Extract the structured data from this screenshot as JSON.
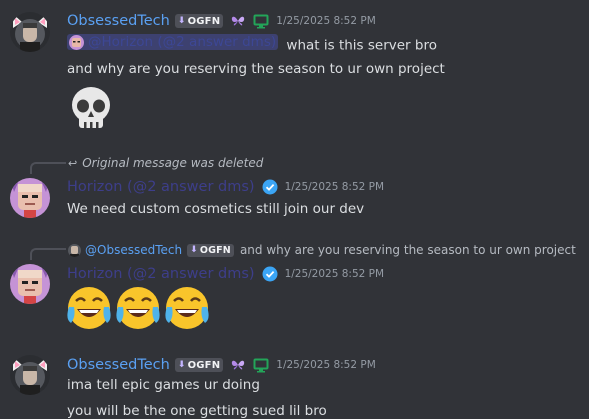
{
  "messages": [
    {
      "author": "ObsessedTech",
      "tag": "OGFN",
      "timestamp": "1/25/2025 8:52 PM",
      "mention": "@Horizon (@2 answer dms)",
      "line1_text": "what is this server bro",
      "line2_text": "and why are you reserving the season to ur own project",
      "emoji": "💀"
    },
    {
      "reply_note": "Original message was deleted",
      "author": "Horizon (@2 answer dms)",
      "timestamp": "1/25/2025 8:52 PM",
      "text": "We need custom cosmetics still join our dev"
    },
    {
      "reply_user": "@ObsessedTech",
      "reply_tag": "OGFN",
      "reply_text": "and why are you reserving the season to ur own project",
      "author": "Horizon (@2 answer dms)",
      "timestamp": "1/25/2025 8:52 PM",
      "emojis": [
        "😂",
        "😂",
        "😂"
      ]
    },
    {
      "author": "ObsessedTech",
      "tag": "OGFN",
      "timestamp": "1/25/2025 8:52 PM",
      "line1_text": "ima tell epic games ur doing",
      "line2_text": "you will be the one getting sued lil bro"
    }
  ],
  "colors": {
    "background": "#313338",
    "obsessed_name": "#5aa0f2",
    "horizon_name": "#3e3f8f",
    "timestamp": "#949ba4",
    "verified": "#3ba5f5",
    "screen_icon": "#23a559"
  },
  "icons": [
    "cat-ear-avatar",
    "ogfn-tag-icon",
    "butterfly-icon",
    "monitor-icon",
    "verified-icon",
    "reply-arrow-icon",
    "skull-emoji",
    "laughing-emoji"
  ]
}
